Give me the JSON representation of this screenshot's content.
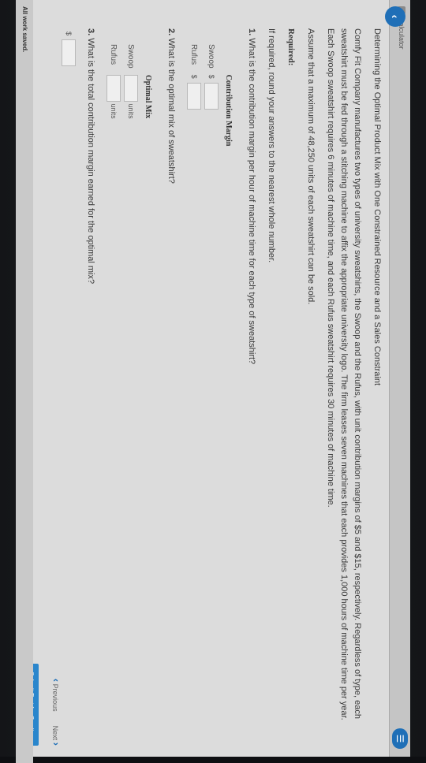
{
  "toolbar": {
    "calculator_label": "Calculator",
    "menu_icon": "menu-icon"
  },
  "problem": {
    "title": "Determining the Optimal Product Mix with One Constrained Resource and a Sales Constraint",
    "paragraph1": "Comfy Fit Company manufactures two types of university sweatshirts, the Swoop and the Rufus, with unit contribution margins of $5 and $15, respectively. Regardless of type, each sweatshirt must be fed through a stitching machine to affix the appropriate university logo. The firm leases seven machines that each provides 1,000 hours of machine time per year. Each Swoop sweatshirt requires 6 minutes of machine time, and each Rufus sweatshirt requires 30 minutes of machine time.",
    "paragraph2": "Assume that a maximum of 48,250 units of each sweatshirt can be sold.",
    "required_heading": "Required:",
    "rounding_note": "If required, round your answers to the nearest whole number."
  },
  "q1": {
    "number": "1.",
    "text": "What is the contribution margin per hour of machine time for each type of sweatshirt?",
    "table_header": "Contribution Margin",
    "rows": [
      {
        "label": "Swoop",
        "prefix": "$"
      },
      {
        "label": "Rufus",
        "prefix": "$"
      }
    ]
  },
  "q2": {
    "number": "2.",
    "text": "What is the optimal mix of sweatshirt?",
    "table_header": "Optimal Mix",
    "rows": [
      {
        "label": "Swoop",
        "units": "units"
      },
      {
        "label": "Rufus",
        "units": "units"
      }
    ]
  },
  "q3": {
    "number": "3.",
    "text": "What is the total contribution margin earned for the optimal mix?",
    "prefix": "$"
  },
  "nav": {
    "previous_label": "Previous",
    "next_label": "Next",
    "submit_label": "Submit Test for Grading"
  },
  "status": {
    "saved_text": "All work saved."
  }
}
